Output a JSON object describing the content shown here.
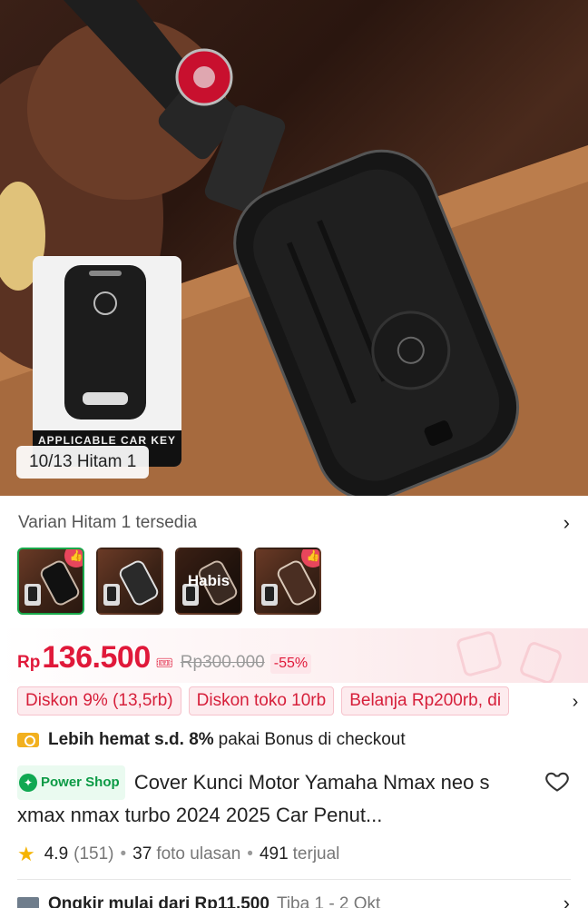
{
  "gallery": {
    "counter": "10/13 Hitam 1",
    "inset_caption": "APPLICABLE CAR KEY"
  },
  "variant": {
    "label": "Varian Hitam 1 tersedia",
    "thumbs": [
      {
        "state": "selected",
        "liked": true
      },
      {
        "state": "available",
        "liked": false
      },
      {
        "state": "sold_out",
        "label": "Habis"
      },
      {
        "state": "available",
        "liked": true
      }
    ]
  },
  "price": {
    "currency": "Rp",
    "amount": "136.500",
    "original": "Rp300.000",
    "discount": "-55%"
  },
  "promos": [
    "Diskon 9% (13,5rb)",
    "Diskon toko 10rb",
    "Belanja Rp200rb, di"
  ],
  "bonus": {
    "bold": "Lebih hemat s.d. 8%",
    "text": "pakai Bonus di checkout"
  },
  "product": {
    "badge": "Power Shop",
    "title": "Cover Kunci Motor Yamaha Nmax neo s xmax nmax turbo 2024 2025 Car Penut..."
  },
  "stats": {
    "rating": "4.9",
    "reviews": "(151)",
    "photo_count": "37",
    "photo_label": "foto ulasan",
    "sold_count": "491",
    "sold_label": "terjual"
  },
  "shipping": {
    "label": "Ongkir mulai dari Rp11.500",
    "eta": "Tiba 1 - 2 Okt"
  },
  "colors": {
    "price_red": "#e0193a",
    "power_green": "#10a852",
    "selected_border": "#18a84a"
  }
}
